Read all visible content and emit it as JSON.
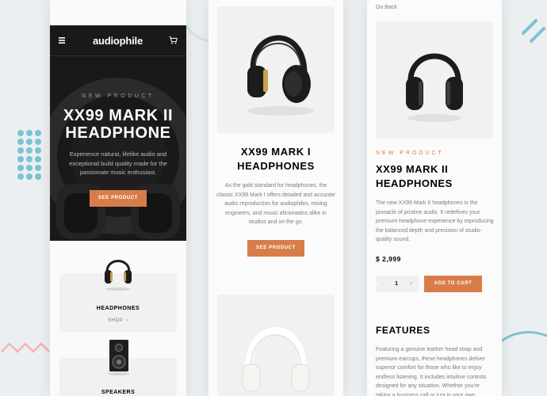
{
  "colors": {
    "accent": "#d87d4a",
    "dark": "#191919",
    "deco_blue": "#7cc3d4",
    "deco_pink": "#f2b4b8"
  },
  "phone1": {
    "nav": {
      "logo": "audiophile",
      "menu_icon": "hamburger-icon",
      "cart_icon": "cart-icon"
    },
    "hero": {
      "overline": "NEW PRODUCT",
      "title": "XX99 MARK II HEADPHONE",
      "description": "Experience natural, lifelike audio and exceptional build quality made for the passionate music enthusiast.",
      "button": "SEE PRODUCT"
    },
    "categories": [
      {
        "title": "HEADPHONES",
        "shop": "SHOP"
      },
      {
        "title": "SPEAKERS"
      }
    ]
  },
  "phone2": {
    "product": {
      "title_line1": "XX99 MARK I",
      "title_line2": "HEADPHONES",
      "description": "As the gold standard for headphones, the classic XX99 Mark I offers detailed and accurate audio reproduction for audiophiles, mixing engineers, and music aficionados alike in studios and on the go.",
      "button": "SEE PRODUCT"
    }
  },
  "phone3": {
    "go_back": "Go Back",
    "overline": "NEW PRODUCT",
    "title_line1": "XX99 MARK II",
    "title_line2": "HEADPHONES",
    "description": "The new XX99 Mark II headphones is the pinnacle of pristine audio. It redefines your premium headphone experience by reproducing the balanced depth and precision of studio-quality sound.",
    "price": "$ 2,999",
    "stepper": {
      "minus": "-",
      "quantity": "1",
      "plus": "+"
    },
    "add_to_cart": "ADD TO CART",
    "features_title": "FEATURES",
    "features_text": "Featuring a genuine leather head strap and premium earcups, these headphones deliver superior comfort for those who like to enjoy endless listening. It includes intuitive controls designed for any situation. Whether you're taking a business call or just in your own"
  }
}
